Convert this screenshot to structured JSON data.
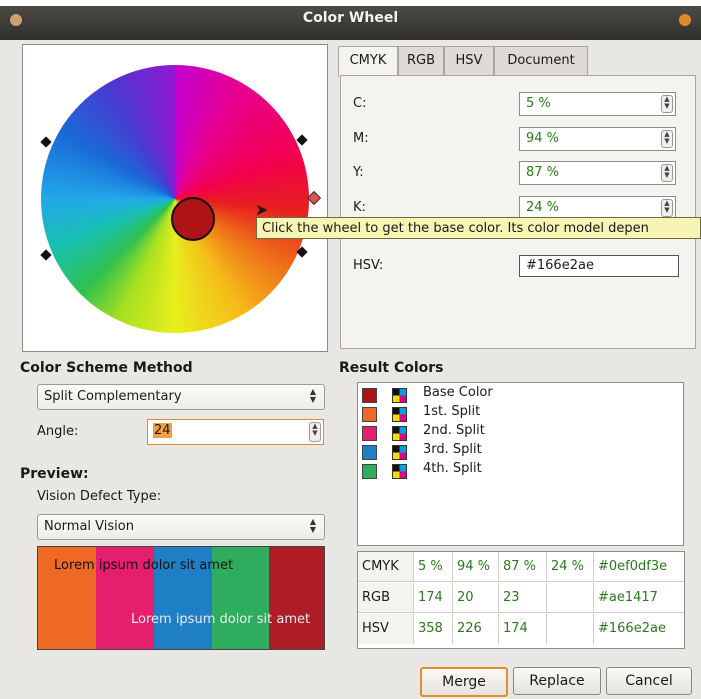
{
  "window": {
    "title": "Color Wheel"
  },
  "colors": {
    "base": "#ae1417",
    "accent": "#e68b2c"
  },
  "tabs": [
    {
      "label": "CMYK",
      "active": true
    },
    {
      "label": "RGB",
      "active": false
    },
    {
      "label": "HSV",
      "active": false
    },
    {
      "label": "Document",
      "active": false
    }
  ],
  "cmyk": {
    "c_label": "C:",
    "c_value": "5 %",
    "m_label": "M:",
    "m_value": "94 %",
    "y_label": "Y:",
    "y_value": "87 %",
    "k_label": "K:",
    "k_value": "24 %",
    "hsv_label": "HSV:",
    "hsv_value": "#166e2ae"
  },
  "tooltip": "Click the wheel to get the base color. Its color model depen",
  "scheme": {
    "heading": "Color Scheme Method",
    "selected": "Split Complementary",
    "angle_label": "Angle:",
    "angle_value": "24"
  },
  "preview": {
    "heading": "Preview:",
    "vision_label": "Vision Defect Type:",
    "vision_selected": "Normal Vision",
    "text_top": "Lorem ipsum dolor sit amet",
    "text_bottom": "Lorem ipsum dolor sit amet",
    "strips": [
      "#ee6a24",
      "#e51e6e",
      "#1f7fc4",
      "#2fad5e",
      "#ae1d26"
    ]
  },
  "results": {
    "heading": "Result Colors",
    "items": [
      {
        "label": "Base Color",
        "color": "#ae1417"
      },
      {
        "label": "1st. Split",
        "color": "#ee6a24"
      },
      {
        "label": "2nd. Split",
        "color": "#e51e6e"
      },
      {
        "label": "3rd. Split",
        "color": "#1f7fc4"
      },
      {
        "label": "4th. Split",
        "color": "#2fad5e"
      }
    ]
  },
  "value_table": {
    "rows": [
      {
        "name": "CMYK",
        "v1": "5 %",
        "v2": "94 %",
        "v3": "87 %",
        "v4": "24 %",
        "hex": "#0ef0df3e"
      },
      {
        "name": "RGB",
        "v1": "174",
        "v2": "20",
        "v3": "23",
        "v4": "",
        "hex": "#ae1417"
      },
      {
        "name": "HSV",
        "v1": "358",
        "v2": "226",
        "v3": "174",
        "v4": "",
        "hex": "#166e2ae"
      }
    ]
  },
  "buttons": {
    "merge": "Merge",
    "replace": "Replace",
    "cancel": "Cancel"
  }
}
